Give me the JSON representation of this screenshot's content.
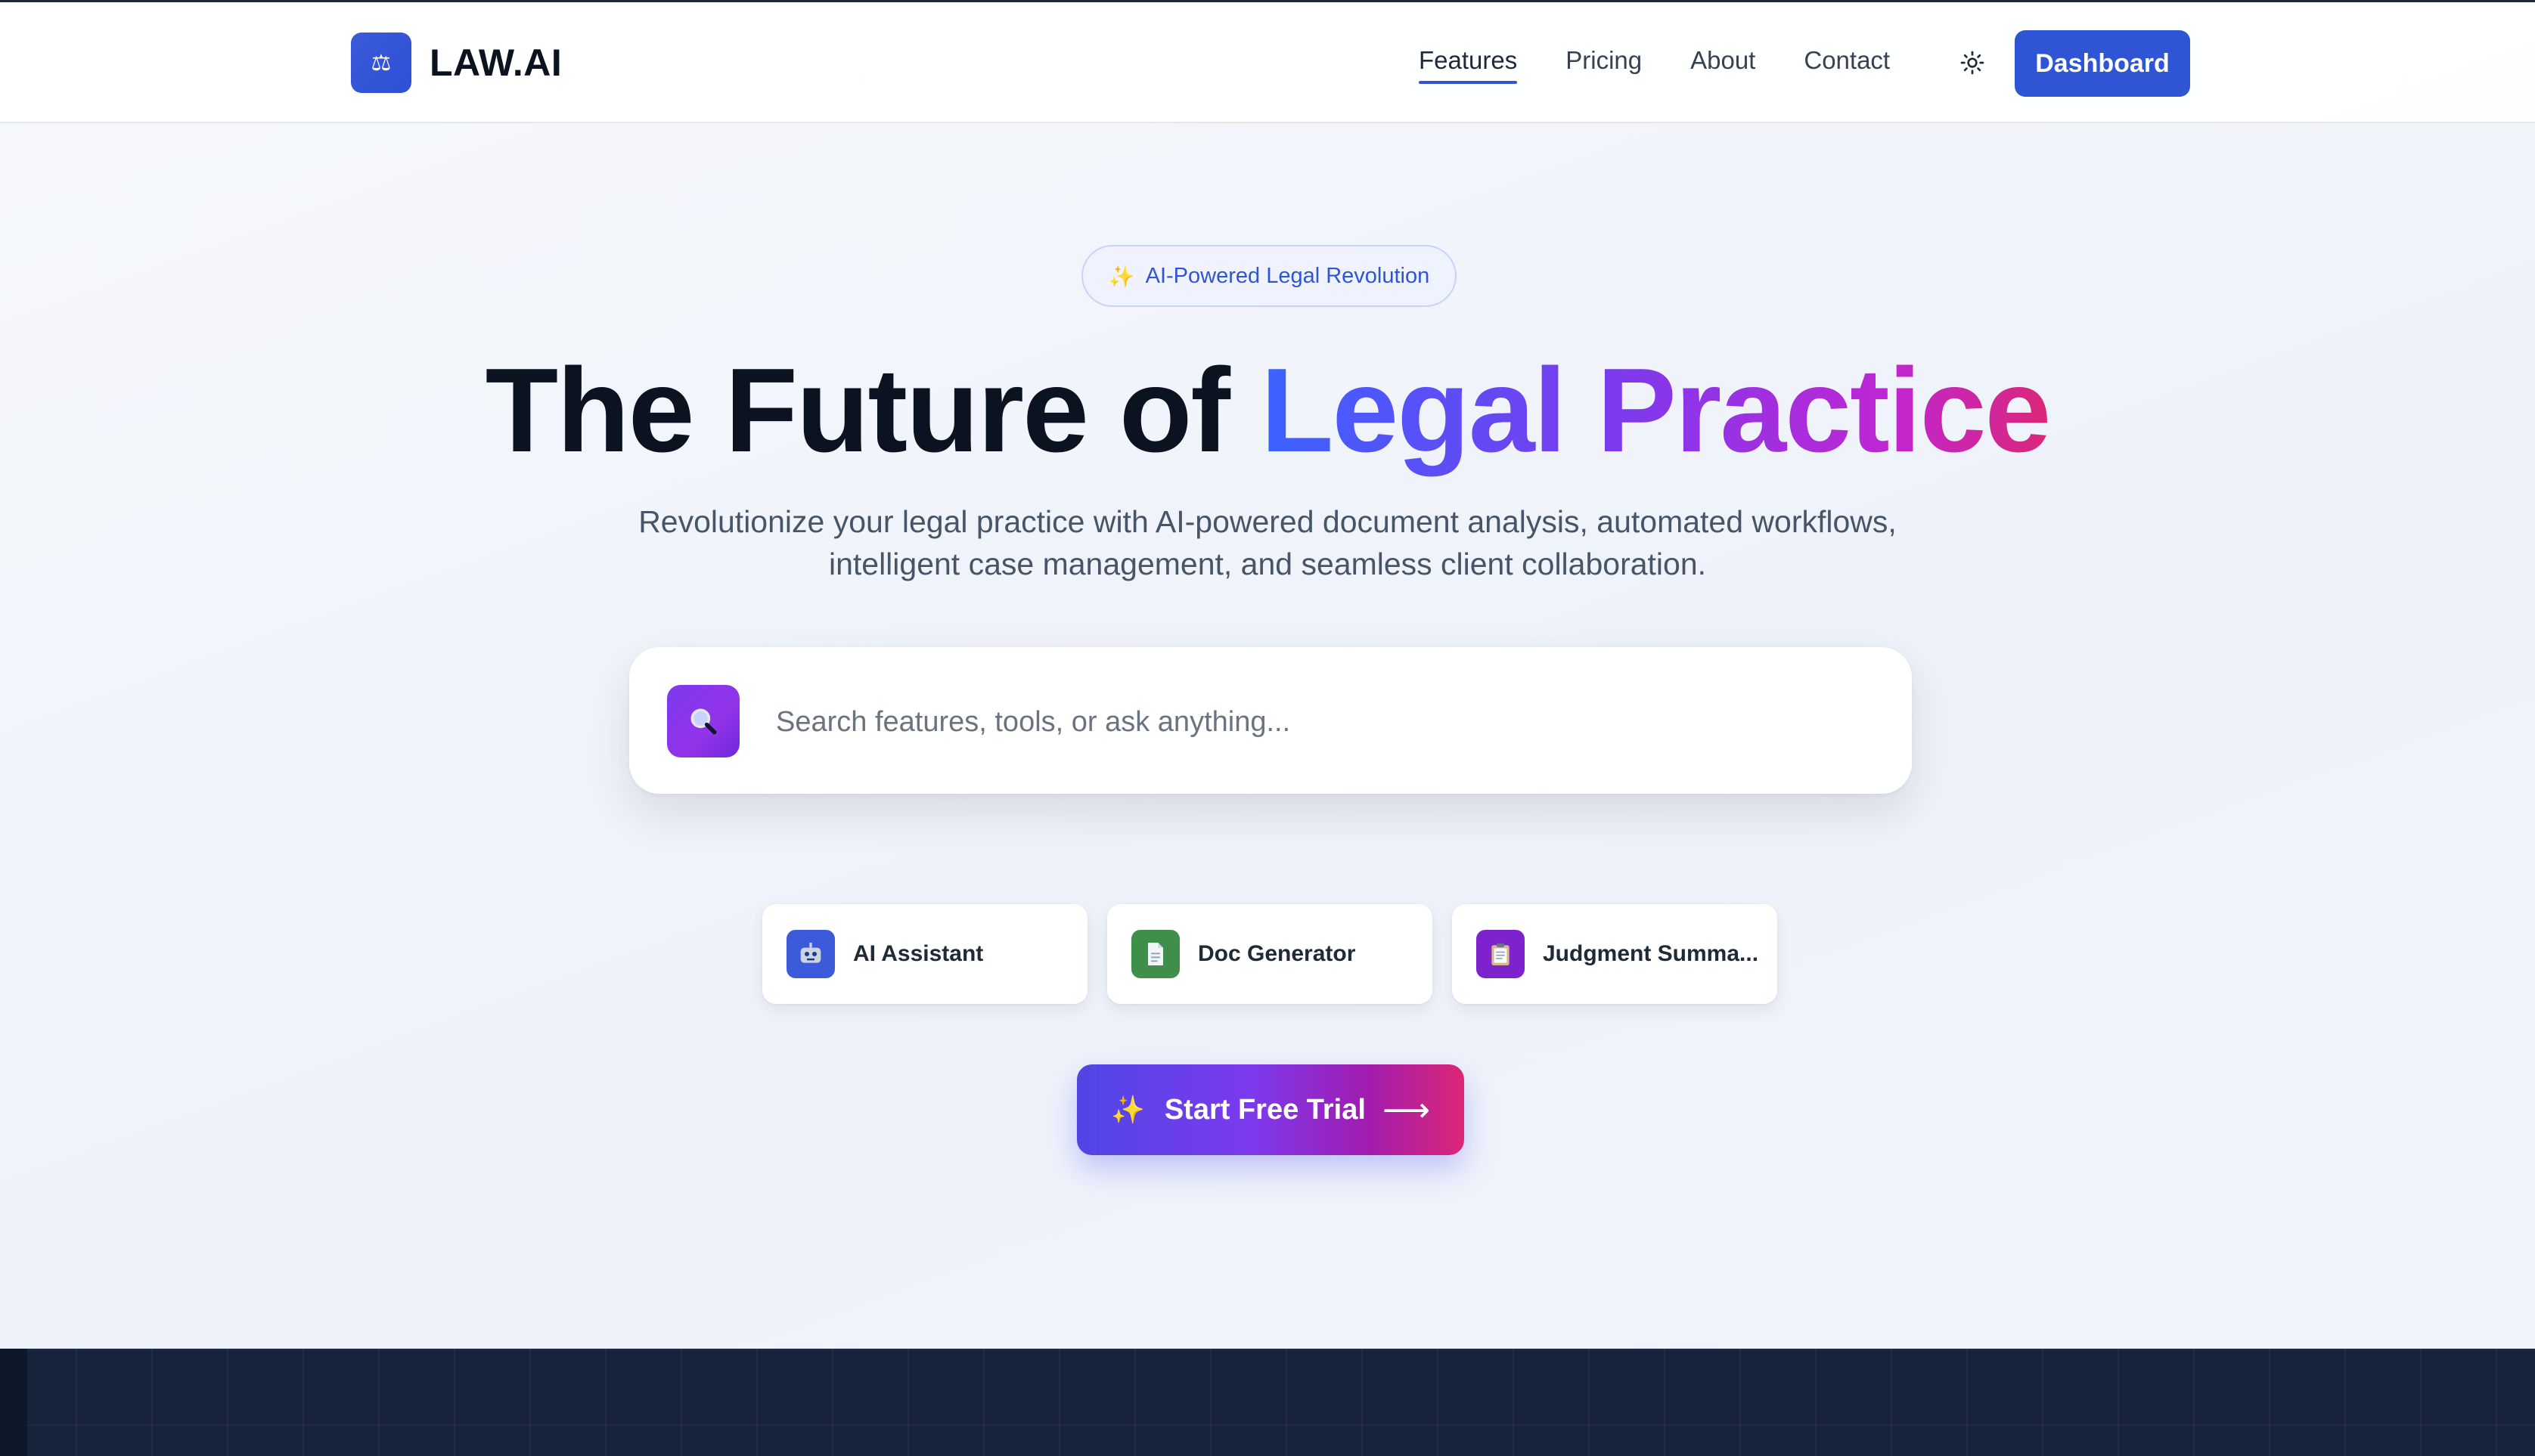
{
  "brand": {
    "name": "LAW.AI",
    "logo_icon": "scales-icon",
    "logo_glyph": "⚖"
  },
  "nav": {
    "links": [
      {
        "label": "Features",
        "active": true
      },
      {
        "label": "Pricing",
        "active": false
      },
      {
        "label": "About",
        "active": false
      },
      {
        "label": "Contact",
        "active": false
      }
    ],
    "theme_icon": "sun-icon",
    "dashboard_label": "Dashboard"
  },
  "hero": {
    "badge": "AI-Powered Legal Revolution",
    "badge_icon": "sparkles-icon",
    "headline_plain": "The Future of ",
    "headline_gradient": "Legal Practice",
    "subtitle_line1": "Revolutionize your legal practice with AI-powered document analysis, automated workflows,",
    "subtitle_line2": "intelligent case management, and seamless client collaboration."
  },
  "search": {
    "placeholder": "Search features, tools, or ask anything...",
    "value": "",
    "icon": "magnifier-icon"
  },
  "quick_tools": [
    {
      "label": "AI Assistant",
      "icon": "robot-icon",
      "color": "#3b5bdb"
    },
    {
      "label": "Doc Generator",
      "icon": "document-icon",
      "color": "#3f8f4a"
    },
    {
      "label": "Judgment Summa...",
      "icon": "clipboard-icon",
      "color": "#7e22ce"
    }
  ],
  "cta": {
    "label": "Start Free Trial",
    "icon": "sparkles-icon",
    "arrow": "⟶"
  },
  "colors": {
    "primary": "#2f55d4",
    "gradient_start": "#3b63ff",
    "gradient_mid": "#7c3aed",
    "gradient_end": "#db2777",
    "dark_band": "#17223b"
  }
}
